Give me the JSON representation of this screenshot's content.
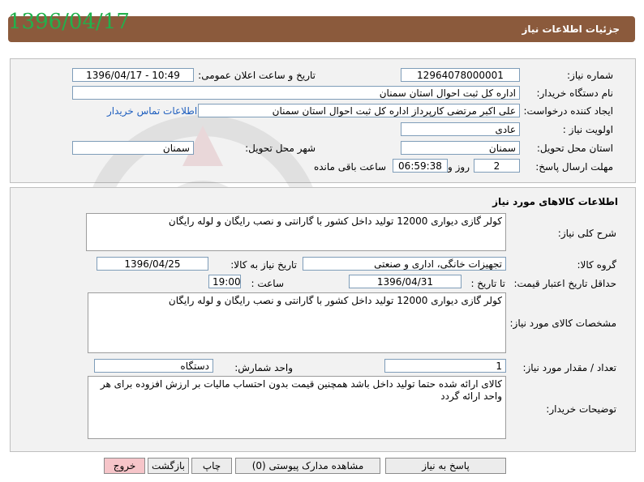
{
  "header": {
    "title": "جزئیات اطلاعات نیاز",
    "date_stamp": "1396/04/17"
  },
  "top": {
    "need_number_label": "شماره نیاز:",
    "need_number": "12964078000001",
    "announce_label": "تاریخ و ساعت اعلان عمومی:",
    "announce_value": "1396/04/17 - 10:49",
    "buyer_org_label": "نام دستگاه خریدار:",
    "buyer_org": "اداره کل ثبت احوال استان سمنان",
    "creator_label": "ایجاد کننده درخواست:",
    "creator": "علی اکبر  مرتضی کارپرداز اداره کل ثبت احوال استان سمنان",
    "contact_link": "اطلاعات تماس خریدار",
    "priority_label": "اولویت نیاز :",
    "priority": "عادی",
    "province_label": "استان محل تحویل:",
    "province": "سمنان",
    "city_label": "شهر محل تحویل:",
    "city": "سمنان",
    "deadline_label": "مهلت ارسال پاسخ:",
    "deadline_days": "2",
    "days_word": "روز و",
    "deadline_time": "06:59:38",
    "remaining_label": "ساعت باقی مانده"
  },
  "goods": {
    "section_title": "اطلاعات کالاهای مورد نیاز",
    "general_desc_label": "شرح کلی نیاز:",
    "general_desc": "کولر گازی دیواری 12000 تولید داخل کشور با گارانتی و نصب رایگان و لوله رایگان",
    "group_label": "گروه کالا:",
    "group": "تجهیزات خانگی، اداری و صنعتی",
    "need_date_label": "تاریخ نیاز به کالا:",
    "need_date": "1396/04/25",
    "validity_label": "حداقل تاریخ اعتبار قیمت:",
    "to_date_label": "تا تاریخ :",
    "to_date": "1396/04/31",
    "time_label": "ساعت :",
    "time": "19:00",
    "specs_label": "مشخصات کالای مورد نیاز:",
    "specs": "کولر گازی دیواری 12000 تولید داخل کشور با گارانتی و نصب رایگان و لوله رایگان",
    "qty_label": "تعداد / مقدار مورد نیاز:",
    "qty": "1",
    "unit_label": "واحد شمارش:",
    "unit": "دستگاه",
    "buyer_notes_label": "توضیحات خریدار:",
    "buyer_notes": "کالای ارائه شده حتما تولید داخل باشد همچنین قیمت بدون احتساب مالیات بر ارزش افزوده برای هر واحد ارائه گردد"
  },
  "buttons": {
    "reply": "پاسخ به نیاز",
    "attachments": "مشاهده مدارک پیوستی (0)",
    "print": "چاپ",
    "back": "بازگشت",
    "exit": "خروج"
  },
  "colors": {
    "header_bg": "#8b5a3c",
    "date_stamp": "#22b14c",
    "link": "#1f5fbf",
    "exit_button": "#f6c5c9"
  }
}
